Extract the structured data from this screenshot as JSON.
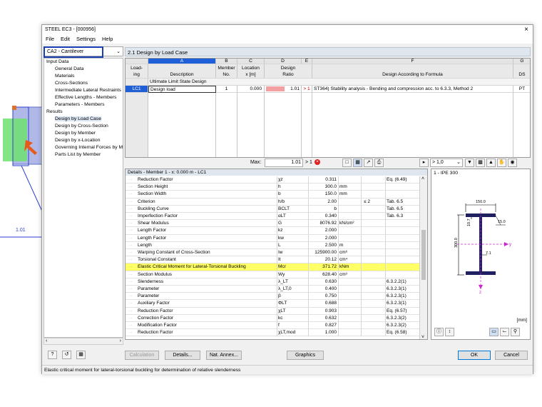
{
  "window": {
    "title": "STEEL EC3 - [000956]",
    "close": "×"
  },
  "menu": [
    "File",
    "Edit",
    "Settings",
    "Help"
  ],
  "loadcase_combo": {
    "value": "CA2 - Cantilever"
  },
  "bg_label": "1.01",
  "nav": {
    "input_header": "Input Data",
    "input_items": [
      "General Data",
      "Materials",
      "Cross-Sections",
      "Intermediate Lateral Restraints",
      "Effective Lengths - Members",
      "Parameters - Members"
    ],
    "results_header": "Results",
    "result_items": [
      "Design by Load Case",
      "Design by Cross-Section",
      "Design by Member",
      "Design by x-Location",
      "Governing Internal Forces by M",
      "Parts List by Member"
    ]
  },
  "panel_title": "2.1 Design by Load Case",
  "table": {
    "col_letters": [
      "A",
      "B",
      "C",
      "D",
      "E",
      "F",
      "G"
    ],
    "h_loading1": "Load-",
    "h_loading2": "ing",
    "h_desc": "Description",
    "h_member1": "Member",
    "h_member2": "No.",
    "h_loc1": "Location",
    "h_loc2": "x [m]",
    "h_ratio1": "Design",
    "h_ratio2": "Ratio",
    "h_formula": "Design According to Formula",
    "h_ds": "DS",
    "group": "Ultimate Limit State Design",
    "row": {
      "lc": "LC1",
      "desc": "Design load",
      "member": "1",
      "loc": "0.000",
      "ratio": "1.01",
      "cmp": "> 1",
      "formula": "ST364) Stability analysis - Bending and compression acc. to 6.3.3, Method 2",
      "ds": "PT"
    }
  },
  "max": {
    "label": "Max:",
    "value": "1.01",
    "cmp": "> 1"
  },
  "filter_value": "> 1,0",
  "details": {
    "title": "Details - Member 1 - x: 0.000 m - LC1",
    "rows": [
      [
        "Reduction Factor",
        "χz",
        "0.311",
        "",
        "",
        "Eq. (6.49)"
      ],
      [
        "Section Height",
        "h",
        "300.0",
        "mm",
        "",
        ""
      ],
      [
        "Section Width",
        "b",
        "150.0",
        "mm",
        "",
        ""
      ],
      [
        "Criterion",
        "h/b",
        "2.00",
        "",
        "≤ 2",
        "Tab. 6.5"
      ],
      [
        "Buckling Curve",
        "BCLT",
        "b",
        "",
        "",
        "Tab. 6.5"
      ],
      [
        "Imperfection Factor",
        "αLT",
        "0.340",
        "",
        "",
        "Tab. 6.3"
      ],
      [
        "Shear Modulus",
        "G",
        "8076.92",
        "kN/cm²",
        "",
        ""
      ],
      [
        "Length Factor",
        "kz",
        "2.000",
        "",
        "",
        ""
      ],
      [
        "Length Factor",
        "kw",
        "2.000",
        "",
        "",
        ""
      ],
      [
        "Length",
        "L",
        "2.500",
        "m",
        "",
        ""
      ],
      [
        "Warping Constant of Cross-Section",
        "Iw",
        "125900.00",
        "cm⁶",
        "",
        ""
      ],
      [
        "Torsional Constant",
        "It",
        "20.12",
        "cm⁴",
        "",
        ""
      ],
      [
        "Elastic Critical Moment for Lateral-Torsional Buckling",
        "Mcr",
        "371.72",
        "kNm",
        "",
        ""
      ],
      [
        "Section Modulus",
        "Wy",
        "628.40",
        "cm³",
        "",
        ""
      ],
      [
        "Slenderness",
        "λ_LT",
        "0.630",
        "",
        "",
        "6.3.2.2(1)"
      ],
      [
        "Parameter",
        "λ_LT,0",
        "0.400",
        "",
        "",
        "6.3.2.3(1)"
      ],
      [
        "Parameter",
        "β",
        "0.750",
        "",
        "",
        "6.3.2.3(1)"
      ],
      [
        "Auxiliary Factor",
        "ΦLT",
        "0.688",
        "",
        "",
        "6.3.2.3(1)"
      ],
      [
        "Reduction Factor",
        "χLT",
        "0.903",
        "",
        "",
        "Eq. (6.57)"
      ],
      [
        "Correction Factor",
        "kc",
        "0.632",
        "",
        "",
        "6.3.2.3(2)"
      ],
      [
        "Modification Factor",
        "f",
        "0.827",
        "",
        "",
        "6.3.2.3(2)"
      ],
      [
        "Reduction Factor",
        "χLT,mod",
        "1.000",
        "",
        "",
        "Eq. (6.58)"
      ]
    ]
  },
  "section": {
    "title": "1 - IPE 300",
    "dim_b": "150.0",
    "dim_t": "15.0",
    "dim_h": "300.0",
    "dim_tf": "10.7",
    "dim_tw": "7.1",
    "axis_y": "y",
    "axis_z": "z",
    "unit": "[mm]"
  },
  "buttons": {
    "calc": "Calculation",
    "details": "Details...",
    "natannex": "Nat. Annex...",
    "graphics": "Graphics",
    "ok": "OK",
    "cancel": "Cancel"
  },
  "status": "Elastic critical moment for lateral-torsional buckling for determination of relative slenderness",
  "colors": {
    "accent": "#1a3fb4",
    "header": "#dfe6ee",
    "ratio_bar": "#f2a0a0",
    "highlight": "#ffff66"
  }
}
